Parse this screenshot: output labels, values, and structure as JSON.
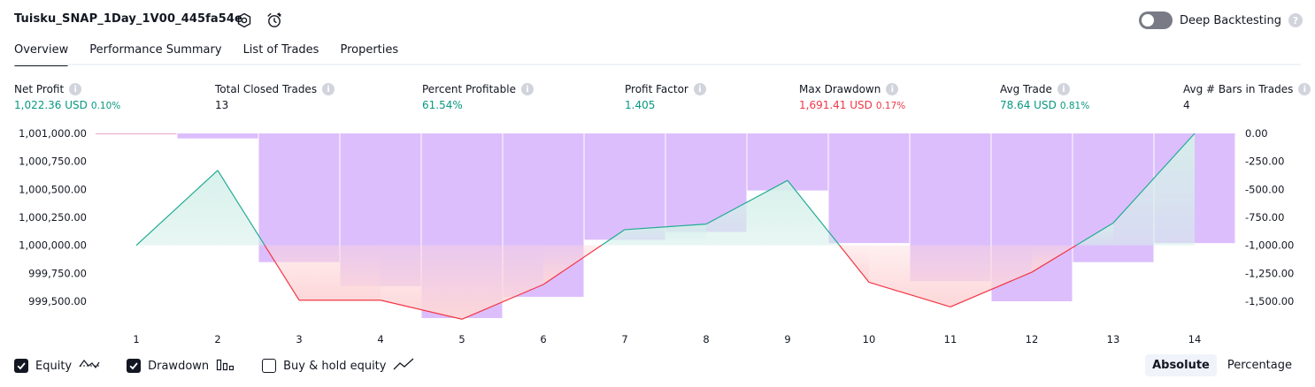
{
  "header": {
    "strategy_name": "Tuisku_SNAP_1Day_1V00_445fa54e",
    "settings_icon": "settings-icon",
    "add_alert_icon": "add-alert-icon",
    "deep_backtesting_label": "Deep Backtesting",
    "deep_backtesting_enabled": false,
    "help_icon": "question-icon"
  },
  "tabs": [
    {
      "label": "Overview",
      "active": true
    },
    {
      "label": "Performance Summary",
      "active": false
    },
    {
      "label": "List of Trades",
      "active": false
    },
    {
      "label": "Properties",
      "active": false
    }
  ],
  "metrics": {
    "net_profit": {
      "label": "Net Profit",
      "value": "1,022.36 USD",
      "pct": "0.10%",
      "tone": "pos"
    },
    "total_closed_trades": {
      "label": "Total Closed Trades",
      "value": "13",
      "tone": "neu"
    },
    "percent_profitable": {
      "label": "Percent Profitable",
      "value": "61.54%",
      "tone": "pos"
    },
    "profit_factor": {
      "label": "Profit Factor",
      "value": "1.405",
      "tone": "pos"
    },
    "max_drawdown": {
      "label": "Max Drawdown",
      "value": "1,691.41 USD",
      "pct": "0.17%",
      "tone": "neg"
    },
    "avg_trade": {
      "label": "Avg Trade",
      "value": "78.64 USD",
      "pct": "0.81%",
      "tone": "pos"
    },
    "avg_bars": {
      "label": "Avg # Bars in Trades",
      "value": "4",
      "tone": "neu"
    }
  },
  "chart_data": {
    "type": "line",
    "x": [
      1,
      2,
      3,
      4,
      5,
      6,
      7,
      8,
      9,
      10,
      11,
      12,
      13,
      14
    ],
    "x_tick_labels": [
      "1",
      "2",
      "3",
      "4",
      "5",
      "6",
      "7",
      "8",
      "9",
      "10",
      "11",
      "12",
      "13",
      "14"
    ],
    "left_axis": {
      "ylim": [
        999350,
        1001000
      ],
      "tick_values": [
        1001000,
        1000750,
        1000500,
        1000250,
        1000000,
        999750,
        999500
      ],
      "tick_labels": [
        "1,001,000.00",
        "1,000,750.00",
        "1,000,500.00",
        "1,000,250.00",
        "1,000,000.00",
        "999,750.00",
        "999,500.00"
      ]
    },
    "right_axis": {
      "ylim": [
        -1650,
        0
      ],
      "tick_values": [
        0,
        -250,
        -500,
        -750,
        -1000,
        -1250,
        -1500
      ],
      "tick_labels": [
        "0.00",
        "-250.00",
        "-500.00",
        "-750.00",
        "-1,000.00",
        "-1,250.00",
        "-1,500.00"
      ]
    },
    "equity": [
      1000000,
      1000670,
      999510,
      999510,
      999340,
      999650,
      1000140,
      1000190,
      1000580,
      999670,
      999450,
      999760,
      1000200,
      1001000
    ],
    "drawdown": [
      0,
      -45,
      -1150,
      -1365,
      -1650,
      -1460,
      -950,
      -880,
      -510,
      -980,
      -1320,
      -1500,
      -1150,
      -980
    ],
    "grid": false,
    "colors": {
      "equity_up": "#22ab94",
      "equity_down": "#f23645",
      "equity_fill_up": "#d6f0ea",
      "equity_fill_down": "#fdd7d9",
      "drawdown_bar": "#dcbefd",
      "drawdown_line": "#e8a6cc",
      "axis_text": "#131722"
    }
  },
  "legend": {
    "items": [
      {
        "label": "Equity",
        "checked": true,
        "icon": "equity-icon"
      },
      {
        "label": "Drawdown",
        "checked": true,
        "icon": "drawdown-bars-icon"
      },
      {
        "label": "Buy & hold equity",
        "checked": false,
        "icon": "buy-hold-line-icon"
      }
    ]
  },
  "mode_toggle": {
    "options": [
      "Absolute",
      "Percentage"
    ],
    "selected": "Absolute"
  }
}
